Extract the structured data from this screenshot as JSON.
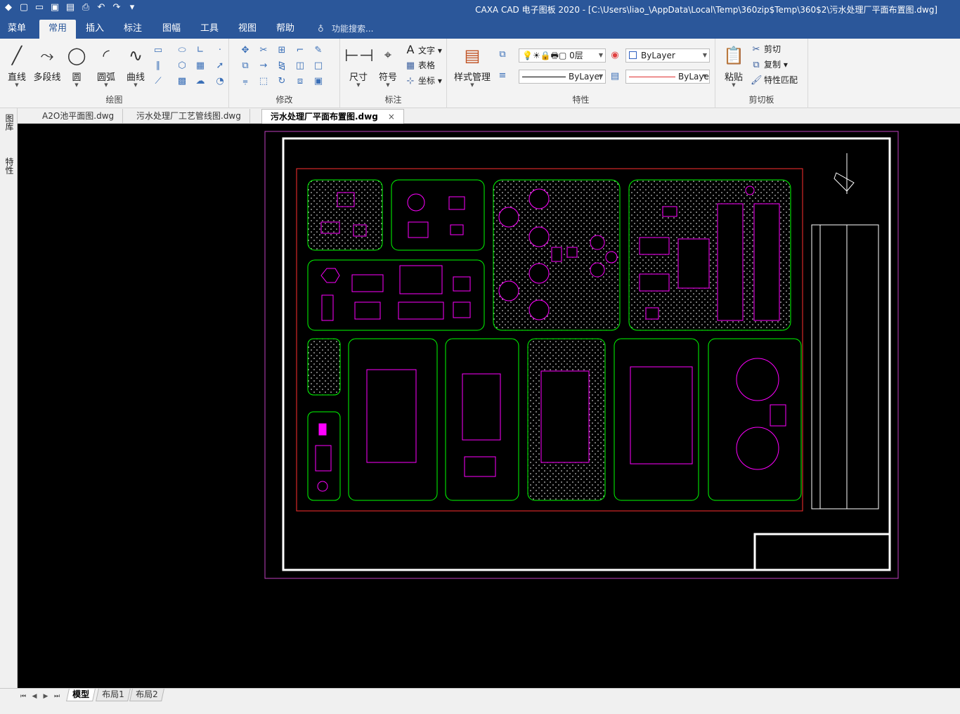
{
  "window": {
    "title": "CAXA CAD 电子图板 2020 - [C:\\Users\\liao_\\AppData\\Local\\Temp\\360zip$Temp\\360$2\\污水处理厂平面布置图.dwg]"
  },
  "menu": {
    "tabs": [
      {
        "label": "菜单"
      },
      {
        "label": "常用"
      },
      {
        "label": "插入"
      },
      {
        "label": "标注"
      },
      {
        "label": "图幅"
      },
      {
        "label": "工具"
      },
      {
        "label": "视图"
      },
      {
        "label": "帮助"
      }
    ],
    "active_index": 1,
    "search_placeholder": "功能搜索..."
  },
  "ribbon": {
    "draw": {
      "label": "绘图",
      "buttons": [
        "直线",
        "多段线",
        "圆",
        "圆弧",
        "曲线"
      ]
    },
    "modify": {
      "label": "修改"
    },
    "annotate": {
      "label": "标注",
      "buttons": [
        "尺寸",
        "符号"
      ],
      "small": [
        "文字",
        "表格",
        "坐标"
      ]
    },
    "properties": {
      "label": "特性",
      "style_button": "样式管理",
      "layer_value": "0层",
      "color_value": "ByLayer",
      "linetype_value": "ByLayer",
      "lineweight_value": "ByLaye"
    },
    "clipboard": {
      "label": "剪切板",
      "paste": "粘贴",
      "small": [
        "剪切",
        "复制",
        "特性匹配"
      ]
    }
  },
  "doc_tabs": [
    {
      "label": "A2O池平面图.dwg"
    },
    {
      "label": "污水处理厂工艺管线图.dwg"
    },
    {
      "label": "污水处理厂平面布置图.dwg",
      "close": "×"
    }
  ],
  "side_panel": [
    "图库",
    "特性"
  ],
  "layout_tabs": [
    {
      "label": "模型"
    },
    {
      "label": "布局1"
    },
    {
      "label": "布局2"
    }
  ],
  "colors": {
    "title_bar": "#2b579a",
    "canvas_bg": "#000000",
    "frame_white": "#ffffff",
    "frame_magenta": "#c040c0",
    "road_green": "#00ff00",
    "building_magenta": "#ff00ff",
    "boundary_red": "#ff3030"
  }
}
